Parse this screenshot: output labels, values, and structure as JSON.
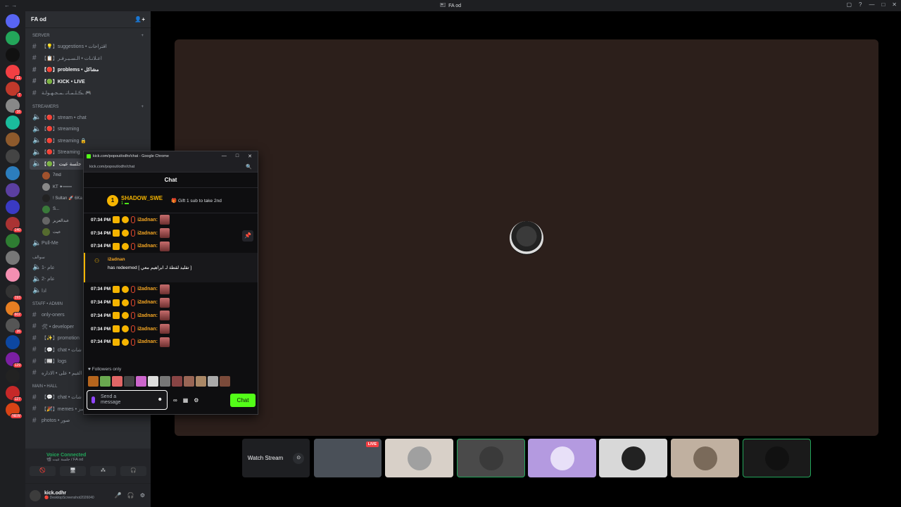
{
  "window": {
    "title": "FA od",
    "back": "← →",
    "controls": [
      "▢",
      "?",
      "—",
      "□",
      "✕"
    ]
  },
  "rail": {
    "servers": [
      {
        "color": "#5865f2",
        "badge": ""
      },
      {
        "color": "#23a55a",
        "badge": ""
      },
      {
        "color": "#111111",
        "badge": ""
      },
      {
        "color": "#f23f43",
        "badge": "31"
      },
      {
        "color": "#c0392b",
        "badge": "7"
      },
      {
        "color": "#888888",
        "badge": "16"
      },
      {
        "color": "#1abc9c",
        "badge": ""
      },
      {
        "color": "#8e5a2c",
        "badge": ""
      },
      {
        "color": "#444444",
        "badge": ""
      },
      {
        "color": "#2c7dbd",
        "badge": ""
      },
      {
        "color": "#5b3fa0",
        "badge": ""
      },
      {
        "color": "#3a3ac4",
        "badge": ""
      },
      {
        "color": "#aa3333",
        "badge": "140"
      },
      {
        "color": "#2e7d32",
        "badge": ""
      },
      {
        "color": "#777777",
        "badge": ""
      },
      {
        "color": "#f48fb1",
        "badge": ""
      },
      {
        "color": "#333333",
        "badge": "193"
      },
      {
        "color": "#e67e22",
        "badge": "602"
      },
      {
        "color": "#555555",
        "badge": "26"
      },
      {
        "color": "#0d47a1",
        "badge": ""
      },
      {
        "color": "#7b1fa2",
        "badge": "129"
      },
      {
        "color": "#222222",
        "badge": ""
      },
      {
        "color": "#c62828",
        "badge": "127"
      },
      {
        "color": "#d84315",
        "badge": "NEW"
      }
    ]
  },
  "sidebar": {
    "server_name": "FA od",
    "cat_server": "SERVER",
    "cat_streamers": "STREAMERS",
    "cat_waf": "سوالف",
    "cat_staff": "STAFF • ADMIN",
    "cat_main": "MAIN • HALL",
    "channels_server": [
      {
        "label": "【💡】suggestions • اقتراحات",
        "bold": false
      },
      {
        "label": "【📋】اعـلانـات • الـسـيـرفـر",
        "bold": false
      },
      {
        "label": "【🔴】problems • مشاكل",
        "bold": true
      },
      {
        "label": "【🟢】KICK • LIVE",
        "bold": true
      },
      {
        "label": "ـڪـلـمـاتـ ـمـجـهـولـة 🎮",
        "bold": false
      }
    ],
    "channels_streamers": [
      {
        "label": "【🔴】stream • chat",
        "bold": false
      },
      {
        "label": "【🔴】streaming",
        "bold": false
      },
      {
        "label": "【🔴】streaming 🔒",
        "bold": false
      },
      {
        "label": "【🔴】Streaming",
        "bold": false
      },
      {
        "label": "【🟢】 جلسة عيت 📽",
        "bold": false
      }
    ],
    "voice_users": [
      {
        "name": "7md",
        "color": "#a0522d"
      },
      {
        "name": "KT ✦═══",
        "color": "#888888"
      },
      {
        "name": "! Sultan 🚀 6Ka",
        "color": "#222222"
      },
      {
        "name": "S...",
        "color": "#3a7a3a"
      },
      {
        "name": "عبدالعزيز",
        "color": "#666666"
      },
      {
        "name": "عيت",
        "color": "#556b2f"
      }
    ],
    "channel_pullme": "Pull-Me",
    "channels_waf": [
      "عام -1",
      "عام -2",
      "اذا"
    ],
    "channels_staff": [
      "only-oners",
      "🛠 • developer",
      "【✨】promotion",
      "【💬】chat • شات",
      "【📰】logs",
      "القيم • على • الاداره"
    ],
    "channels_main": [
      "【💬】chat • شات",
      "【🎉】memes • ميمز",
      "photos • صور"
    ]
  },
  "voice": {
    "status": "Voice Connected",
    "sub": "📽 جلسة عيت / FA od",
    "btns": [
      "🚫",
      "🖥",
      "⁂",
      "🎧"
    ]
  },
  "user": {
    "name": "kick.odhr",
    "status": "🔴 DesktopScreenshot2026040",
    "ctl": [
      "🎤",
      "🎧",
      "⚙"
    ]
  },
  "stage": {
    "watch_label": "Watch Stream",
    "watch_icon": "⊙",
    "live_badge": "LIVE"
  },
  "popout": {
    "window_title": "kick.com/popout/odhr/chat - Google Chrome",
    "url": "kick.com/popout/odhr/chat",
    "zoom_icon": "🔍",
    "wctl": [
      "—",
      "□",
      "✕"
    ],
    "header": "Chat",
    "pinned_rank": "1",
    "pinned_name": "SHADOW_SWE",
    "pinned_count": "1 ▬",
    "gift_text": "🎁 Gift 1 sub to take 2nd",
    "msgs_top": [
      {
        "time": "07:34 PM",
        "user": "i2adnan:"
      },
      {
        "time": "07:34 PM",
        "user": "i2adnan:"
      },
      {
        "time": "07:34 PM",
        "user": "i2adnan:"
      }
    ],
    "redeem_user": "i2adnan",
    "redeem_text": "has redeemed [ تقليد لقطة لـ ابراهيم معي ]",
    "msgs_bottom": [
      {
        "time": "07:34 PM",
        "user": "i2adnan:"
      },
      {
        "time": "07:34 PM",
        "user": "i2adnan:"
      },
      {
        "time": "07:34 PM",
        "user": "i2adnan:"
      },
      {
        "time": "07:34 PM",
        "user": "i2adnan:"
      },
      {
        "time": "07:34 PM",
        "user": "i2adnan:"
      }
    ],
    "followers_only": "♥ Followers only",
    "emote_colors": [
      "#b5651d",
      "#6aa84f",
      "#e06666",
      "#444444",
      "#cc66cc",
      "#dddddd",
      "#777777",
      "#884444",
      "#996655",
      "#aa8866",
      "#aaaaaa",
      "#7a4a3a"
    ],
    "placeholder_line1": "Send a",
    "placeholder_line2": "message",
    "send_label": "Chat"
  },
  "participants": [
    {
      "color": "#a0a0a0",
      "speaking": false,
      "bg": "#d8d0c8"
    },
    {
      "color": "#3a3a3a",
      "speaking": true,
      "bg": "#4a4a4a"
    },
    {
      "color": "#e8e0f8",
      "speaking": false,
      "bg": "#b49ae0"
    },
    {
      "color": "#222222",
      "speaking": false,
      "bg": "#d8d8d8"
    },
    {
      "color": "#7a6a5a",
      "speaking": false,
      "bg": "#c0b0a0"
    },
    {
      "color": "#111111",
      "speaking": true,
      "bg": "#1a1a1a"
    }
  ]
}
